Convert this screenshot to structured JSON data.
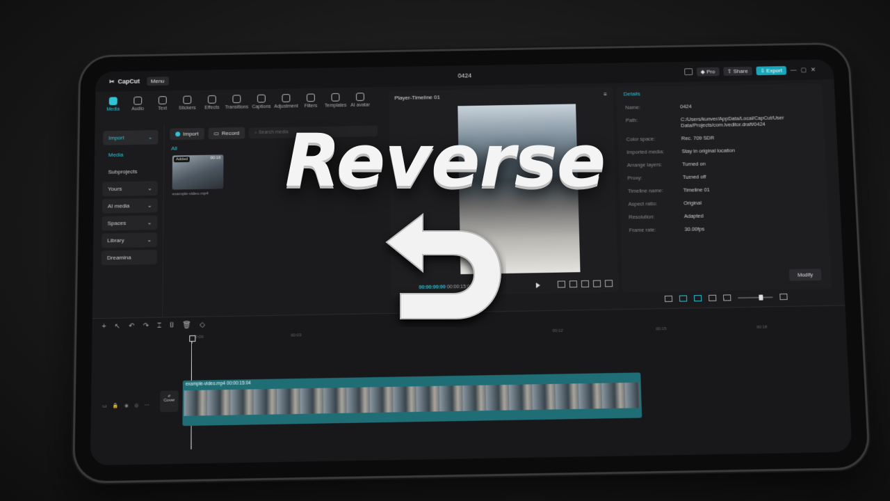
{
  "app": {
    "name": "CapCut",
    "menu_label": "Menu",
    "project_title": "0424"
  },
  "topbar": {
    "pro_label": "Pro",
    "share_label": "Share",
    "export_label": "Export"
  },
  "toolbar": {
    "items": [
      "Media",
      "Audio",
      "Text",
      "Stickers",
      "Effects",
      "Transitions",
      "Captions",
      "Adjustment",
      "Filters",
      "Templates",
      "AI avatar"
    ]
  },
  "leftnav": {
    "import_label": "Import",
    "items": [
      "Media",
      "Subprojects",
      "Yours",
      "AI media",
      "Spaces",
      "Library",
      "Dreamina"
    ]
  },
  "media": {
    "import_button": "Import",
    "record_button": "Record",
    "search_placeholder": "Search media",
    "filter_label": "All",
    "clip": {
      "badge": "Added",
      "duration": "00:16",
      "name": "example-video.mp4"
    }
  },
  "player": {
    "title": "Player-Timeline 01",
    "current_time": "00:00:00:00",
    "total_time": "00:00:15:04"
  },
  "details": {
    "header": "Details",
    "rows": [
      {
        "k": "Name:",
        "v": "0424"
      },
      {
        "k": "Path:",
        "v": "C:/Users/kunver/AppData/Local/CapCut/User Data/Projects/com.lveditor.draft/0424"
      },
      {
        "k": "Color space:",
        "v": "Rec. 709 SDR"
      },
      {
        "k": "Imported media:",
        "v": "Stay in original location"
      },
      {
        "k": "Arrange layers:",
        "v": "Turned on"
      },
      {
        "k": "Proxy:",
        "v": "Turned off"
      },
      {
        "k": "Timeline name:",
        "v": "Timeline 01"
      },
      {
        "k": "Aspect ratio:",
        "v": "Original"
      },
      {
        "k": "Resolution:",
        "v": "Adapted"
      },
      {
        "k": "Frame rate:",
        "v": "30.00fps"
      }
    ],
    "modify_label": "Modify"
  },
  "timeline": {
    "ruler": [
      "00:00",
      "00:03",
      "00:12",
      "00:15",
      "00:18"
    ],
    "cover_label": "Cover",
    "clip_label": "example-video.mp4",
    "clip_duration": "00:00:15:04"
  },
  "overlay": {
    "title": "Reverse"
  }
}
